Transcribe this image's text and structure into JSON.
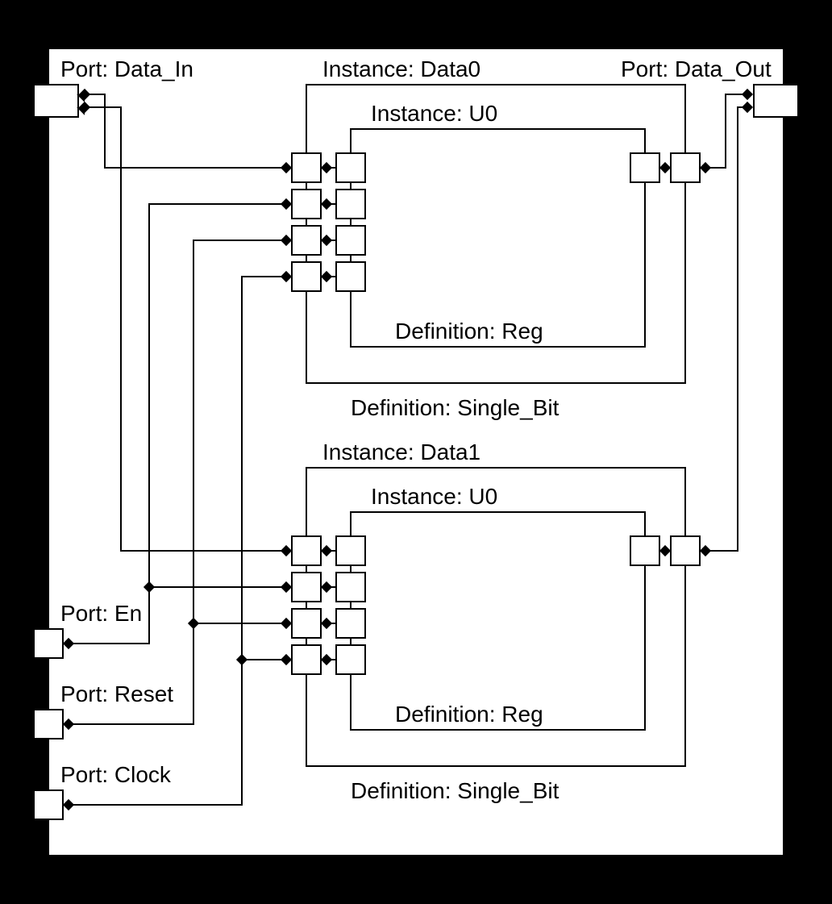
{
  "ports": {
    "data_in": "Port: Data_In",
    "data_out": "Port: Data_Out",
    "en": "Port: En",
    "reset": "Port: Reset",
    "clock": "Port: Clock"
  },
  "instances": {
    "data0": "Instance: Data0",
    "data1": "Instance: Data1",
    "u0_a": "Instance: U0",
    "u0_b": "Instance: U0"
  },
  "definitions": {
    "reg_a": "Definition: Reg",
    "single_bit_a": "Definition: Single_Bit",
    "reg_b": "Definition: Reg",
    "single_bit_b": "Definition: Single_Bit"
  }
}
